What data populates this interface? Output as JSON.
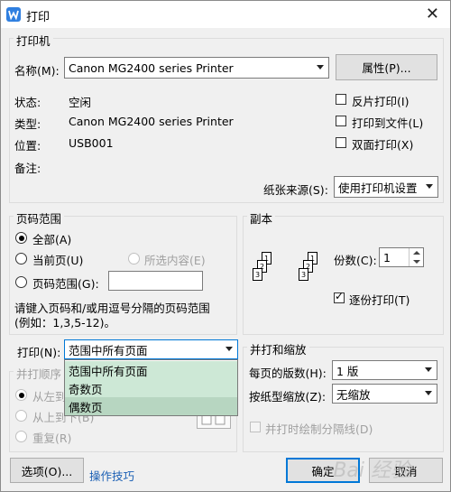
{
  "window": {
    "title": "打印"
  },
  "printer": {
    "legend": "打印机",
    "name_label": "名称(M):",
    "name_value": "Canon MG2400 series Printer",
    "properties_button": "属性(P)...",
    "status_label": "状态:",
    "status_value": "空闲",
    "type_label": "类型:",
    "type_value": "Canon MG2400 series Printer",
    "location_label": "位置:",
    "location_value": "USB001",
    "comment_label": "备注:",
    "reverse_print": "反片打印(I)",
    "reverse_checked": false,
    "print_to_file": "打印到文件(L)",
    "print_to_file_checked": false,
    "duplex": "双面打印(X)",
    "duplex_checked": false,
    "paper_source_label": "纸张来源(S):",
    "paper_source_value": "使用打印机设置"
  },
  "page_range": {
    "legend": "页码范围",
    "all": "全部(A)",
    "all_checked": true,
    "current": "当前页(U)",
    "selection": "所选内容(E)",
    "pages": "页码范围(G):",
    "pages_value": "",
    "hint_line1": "请键入页码和/或用逗号分隔的页码范围",
    "hint_line2": "(例如：1,3,5-12)。"
  },
  "copies": {
    "legend": "副本",
    "count_label": "份数(C):",
    "count_value": "1",
    "collate": "逐份打印(T)",
    "collate_checked": true,
    "page_numbers": [
      "1",
      "2",
      "3",
      "1",
      "2",
      "3"
    ]
  },
  "print_what": {
    "label": "打印(N):",
    "value": "范围中所有页面",
    "options": [
      "范围中所有页面",
      "奇数页",
      "偶数页"
    ]
  },
  "order": {
    "legend": "并打顺序",
    "left_to_right": "从左到",
    "top_to_bottom": "从上到下(B)",
    "repeat": "重复(R)"
  },
  "zoom": {
    "legend": "并打和缩放",
    "pages_per_sheet_label": "每页的版数(H):",
    "pages_per_sheet_value": "1 版",
    "scale_label": "按纸型缩放(Z):",
    "scale_value": "无缩放",
    "draw_borders": "并打时绘制分隔线(D)"
  },
  "footer": {
    "options_button": "选项(O)...",
    "tips_link": "操作技巧",
    "ok_button": "确定",
    "cancel_button": "取消",
    "watermark": "Bai 经验"
  }
}
